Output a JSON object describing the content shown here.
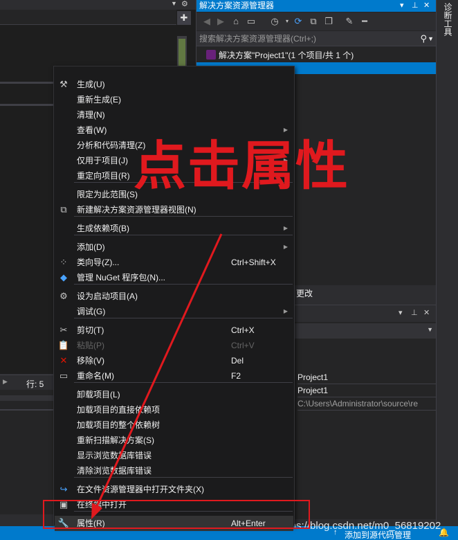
{
  "editor": {
    "line_indicator": "行: 5"
  },
  "solution_explorer": {
    "title": "解决方案资源管理器",
    "search_placeholder": "搜索解决方案资源管理器(Ctrl+;)",
    "solution_label": "解决方案\"Project1\"(1 个项目/共 1 个)",
    "below_label": "更改"
  },
  "side_strip": {
    "title": "诊断工具"
  },
  "properties": {
    "rows": [
      "Project1",
      "Project1",
      "C:\\Users\\Administrator\\source\\re"
    ]
  },
  "status": {
    "source_control": "添加到源代码管理"
  },
  "watermark": "https://blog.csdn.net/m0_56819202",
  "annotation": {
    "text": "点击属性"
  },
  "menu": {
    "items": [
      {
        "label": "生成(U)",
        "icon": "build-icon"
      },
      {
        "label": "重新生成(E)"
      },
      {
        "label": "清理(N)"
      },
      {
        "label": "查看(W)",
        "submenu": true
      },
      {
        "label": "分析和代码清理(Z)",
        "submenu": true
      },
      {
        "label": "仅用于项目(J)",
        "submenu": true
      },
      {
        "label": "重定向项目(R)"
      },
      {
        "label": "限定为此范围(S)"
      },
      {
        "label": "新建解决方案资源管理器视图(N)",
        "icon": "new-view-icon"
      },
      {
        "label": "生成依赖项(B)",
        "submenu": true
      },
      {
        "label": "添加(D)",
        "submenu": true
      },
      {
        "label": "类向导(Z)...",
        "shortcut": "Ctrl+Shift+X",
        "icon": "class-wizard-icon"
      },
      {
        "label": "管理 NuGet 程序包(N)...",
        "icon": "nuget-icon"
      },
      {
        "label": "设为启动项目(A)",
        "icon": "gear-icon"
      },
      {
        "label": "调试(G)",
        "submenu": true
      },
      {
        "label": "剪切(T)",
        "shortcut": "Ctrl+X",
        "icon": "scissors-icon"
      },
      {
        "label": "粘贴(P)",
        "shortcut": "Ctrl+V",
        "icon": "paste-icon",
        "disabled": true
      },
      {
        "label": "移除(V)",
        "shortcut": "Del",
        "icon": "remove-icon"
      },
      {
        "label": "重命名(M)",
        "shortcut": "F2",
        "icon": "rename-icon"
      },
      {
        "label": "卸载项目(L)"
      },
      {
        "label": "加载项目的直接依赖项"
      },
      {
        "label": "加载项目的整个依赖树"
      },
      {
        "label": "重新扫描解决方案(S)"
      },
      {
        "label": "显示浏览数据库错误"
      },
      {
        "label": "清除浏览数据库错误"
      },
      {
        "label": "在文件资源管理器中打开文件夹(X)",
        "icon": "open-folder-icon"
      },
      {
        "label": "在终端中打开",
        "icon": "terminal-icon"
      },
      {
        "label": "属性(R)",
        "shortcut": "Alt+Enter",
        "icon": "wrench-icon"
      }
    ]
  },
  "colors": {
    "accent": "#007acc",
    "annotation": "#e0191e",
    "menu_bg": "#1b1b1c"
  }
}
